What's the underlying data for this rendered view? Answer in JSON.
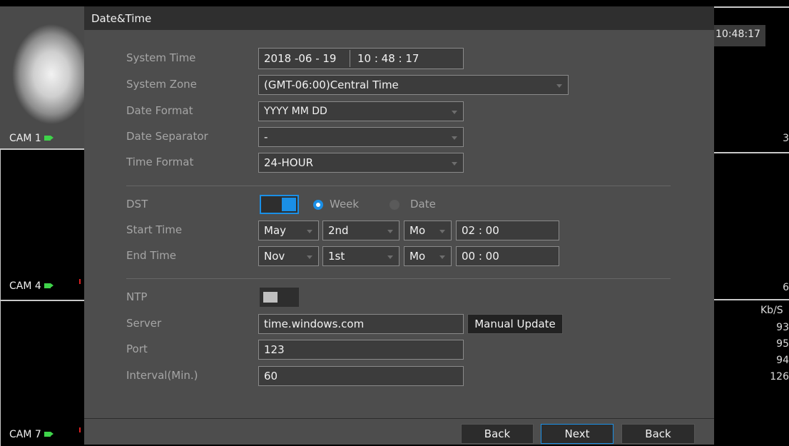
{
  "cameras": [
    {
      "label": "CAM 1"
    },
    {
      "label": "CAM 4"
    },
    {
      "label": "CAM 7"
    }
  ],
  "right_panel": {
    "clock": "10:48:17",
    "edge_values": [
      "3",
      "6"
    ],
    "bitrate_header": "Kb/S",
    "bitrates": [
      "93",
      "95",
      "94",
      "126"
    ]
  },
  "dialog": {
    "title": "Date&Time",
    "system_time": {
      "label": "System Time",
      "date": "2018 -06 - 19",
      "time": "10 : 48 : 17"
    },
    "system_zone": {
      "label": "System Zone",
      "value": "(GMT-06:00)Central Time"
    },
    "date_format": {
      "label": "Date Format",
      "value": "YYYY MM DD"
    },
    "date_separator": {
      "label": "Date Separator",
      "value": "-"
    },
    "time_format": {
      "label": "Time Format",
      "value": "24-HOUR"
    },
    "dst": {
      "label": "DST",
      "enabled": true,
      "mode_week": "Week",
      "mode_date": "Date",
      "selected_mode": "Week"
    },
    "start_time": {
      "label": "Start Time",
      "month": "May",
      "week": "2nd",
      "day": "Mo",
      "time": "02 : 00"
    },
    "end_time": {
      "label": "End Time",
      "month": "Nov",
      "week": "1st",
      "day": "Mo",
      "time": "00 : 00"
    },
    "ntp": {
      "label": "NTP",
      "enabled": false
    },
    "server": {
      "label": "Server",
      "value": "time.windows.com",
      "update_button": "Manual Update"
    },
    "port": {
      "label": "Port",
      "value": "123"
    },
    "interval": {
      "label": "Interval(Min.)",
      "value": "60"
    },
    "footer": {
      "back1": "Back",
      "next": "Next",
      "back2": "Back"
    }
  },
  "colors": {
    "accent": "#1a8fe6",
    "camera_icon": "#3fd34a"
  }
}
